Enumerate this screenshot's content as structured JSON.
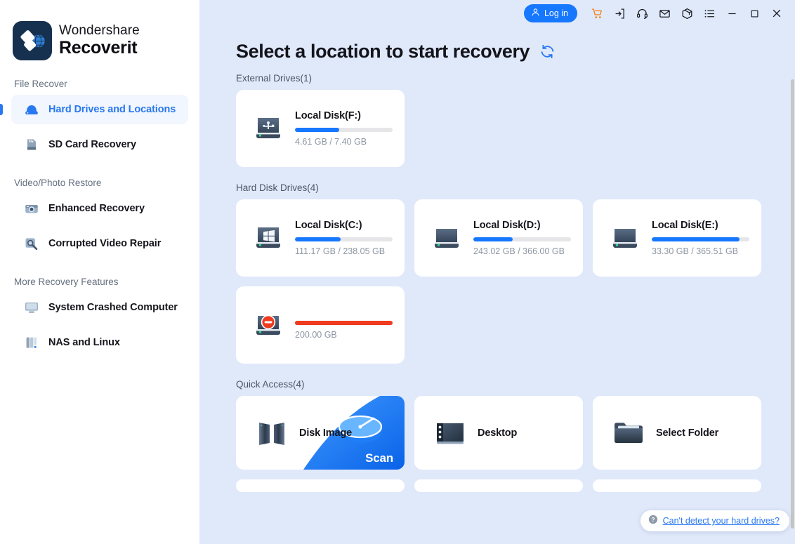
{
  "brand": {
    "line1": "Wondershare",
    "line2": "Recoverit",
    "logo_icon": "recoverit-logo",
    "logo_color": "#16314f"
  },
  "sidebar": {
    "groups": [
      {
        "label": "File Recover",
        "items": [
          {
            "label": "Hard Drives and Locations",
            "icon": "hard-drive-icon",
            "active": true
          },
          {
            "label": "SD Card Recovery",
            "icon": "sd-card-icon",
            "active": false
          }
        ]
      },
      {
        "label": "Video/Photo Restore",
        "items": [
          {
            "label": "Enhanced Recovery",
            "icon": "camera-icon",
            "active": false
          },
          {
            "label": "Corrupted Video Repair",
            "icon": "video-repair-icon",
            "active": false
          }
        ]
      },
      {
        "label": "More Recovery Features",
        "items": [
          {
            "label": "System Crashed Computer",
            "icon": "monitor-icon",
            "active": false
          },
          {
            "label": "NAS and Linux",
            "icon": "nas-server-icon",
            "active": false
          }
        ]
      }
    ]
  },
  "titlebar": {
    "login_label": "Log in",
    "login_icon": "user-icon",
    "login_color": "#1677ff",
    "icons": [
      {
        "name": "cart-icon",
        "color": "#f5841f"
      },
      {
        "name": "sign-in-icon",
        "color": "#1b1b22"
      },
      {
        "name": "headset-support-icon",
        "color": "#1b1b22"
      },
      {
        "name": "mail-icon",
        "color": "#1b1b22"
      },
      {
        "name": "package-box-icon",
        "color": "#1b1b22"
      },
      {
        "name": "list-menu-icon",
        "color": "#1b1b22"
      },
      {
        "name": "minimize-icon",
        "color": "#1b1b22"
      },
      {
        "name": "maximize-icon",
        "color": "#1b1b22"
      },
      {
        "name": "close-icon",
        "color": "#1b1b22"
      }
    ]
  },
  "header": {
    "title": "Select a location to start recovery",
    "refresh_icon": "refresh-icon",
    "refresh_color": "#2878f0"
  },
  "sections": [
    {
      "label": "External Drives(1)",
      "type": "drives",
      "cards": [
        {
          "name": "Local Disk(F:)",
          "size_text": "4.61 GB / 7.40 GB",
          "used_pct": 45,
          "icon": "usb-drive-icon",
          "bar_color": "#1677ff"
        }
      ]
    },
    {
      "label": "Hard Disk Drives(4)",
      "type": "drives",
      "cards": [
        {
          "name": "Local Disk(C:)",
          "size_text": "111.17 GB / 238.05 GB",
          "used_pct": 47,
          "icon": "windows-drive-icon",
          "bar_color": "#1677ff"
        },
        {
          "name": "Local Disk(D:)",
          "size_text": "243.02 GB / 366.00 GB",
          "used_pct": 40,
          "icon": "hard-drive-icon",
          "bar_color": "#1677ff"
        },
        {
          "name": "Local Disk(E:)",
          "size_text": "33.30 GB / 365.51 GB",
          "used_pct": 90,
          "icon": "hard-drive-icon",
          "bar_color": "#1677ff"
        },
        {
          "name": "",
          "size_text": "200.00 GB",
          "used_pct": 100,
          "icon": "lost-partition-icon",
          "bar_color": "#ef3b1f"
        }
      ]
    },
    {
      "label": "Quick Access(4)",
      "type": "quick",
      "cards": [
        {
          "name": "Disk Image",
          "icon": "disk-image-icon",
          "hovered": true,
          "overlay_label": "Scan"
        },
        {
          "name": "Desktop",
          "icon": "desktop-icon",
          "hovered": false,
          "overlay_label": ""
        },
        {
          "name": "Select Folder",
          "icon": "folder-icon",
          "hovered": false,
          "overlay_label": ""
        }
      ]
    }
  ],
  "help": {
    "text": "Can't detect your hard drives?",
    "icon": "question-mark-icon",
    "color": "#2878f0"
  },
  "scrollbar": {
    "name": "vertical-scrollbar"
  }
}
